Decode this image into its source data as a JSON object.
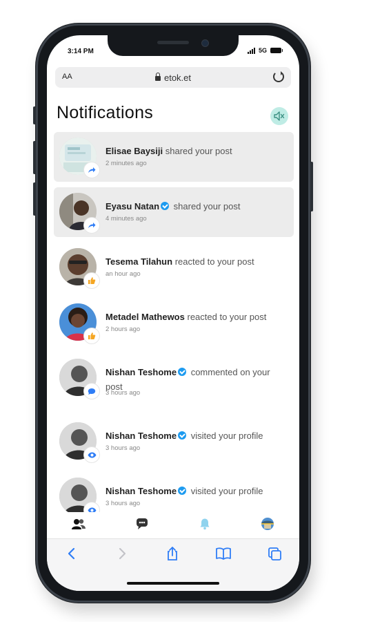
{
  "status": {
    "time": "3:14 PM",
    "network": "5G"
  },
  "browser": {
    "text_size": "AA",
    "host": "etok.et"
  },
  "page": {
    "title": "Notifications"
  },
  "notifications": [
    {
      "name": "Elisae Baysiji",
      "action": "shared your post",
      "time": "2 minutes ago",
      "verified": false,
      "unread": true,
      "type": "share"
    },
    {
      "name": "Eyasu Natan",
      "action": "shared your post",
      "time": "4 minutes ago",
      "verified": true,
      "unread": true,
      "type": "share"
    },
    {
      "name": "Tesema Tilahun",
      "action": "reacted to your post",
      "time": "an hour ago",
      "verified": false,
      "unread": false,
      "type": "reaction"
    },
    {
      "name": "Metadel Mathewos",
      "action": "reacted to your post",
      "time": "2 hours ago",
      "verified": false,
      "unread": false,
      "type": "reaction"
    },
    {
      "name": "Nishan Teshome",
      "action": "commented on your post",
      "time": "3 hours ago",
      "verified": true,
      "unread": false,
      "type": "comment"
    },
    {
      "name": "Nishan Teshome",
      "action": "visited your profile",
      "time": "3 hours ago",
      "verified": true,
      "unread": false,
      "type": "visit"
    },
    {
      "name": "Nishan Teshome",
      "action": "visited your profile",
      "time": "3 hours ago",
      "verified": true,
      "unread": false,
      "type": "visit"
    }
  ],
  "tabs": [
    "friends-icon",
    "messages-icon",
    "notifications-bell-icon",
    "profile-avatar-icon"
  ],
  "colors": {
    "accent": "#1d9bf0",
    "mute_bg": "#bfece5",
    "unread_bg": "#ececec",
    "browser_blue": "#2f7df6"
  }
}
